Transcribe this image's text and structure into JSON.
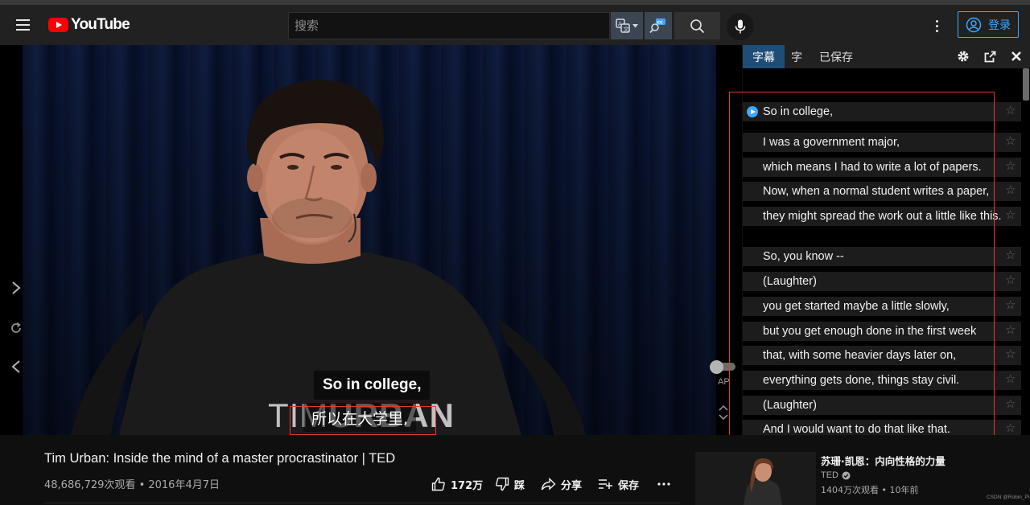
{
  "header": {
    "logo_text": "YouTube",
    "search_placeholder": "搜索",
    "login_label": "登录"
  },
  "player": {
    "caption_en": "So in college,",
    "caption_zh": "所以在大学里,",
    "speaker_first": "TIM",
    "speaker_last": "URBAN",
    "autoplay_label": "AP"
  },
  "panel": {
    "tabs": [
      {
        "label": "字幕",
        "active": true
      },
      {
        "label": "字",
        "active": false
      },
      {
        "label": "已保存",
        "active": false
      }
    ],
    "lines": [
      {
        "text": "So in college,",
        "playing": true
      },
      {
        "text": "I was a government major,",
        "playing": false
      },
      {
        "text": "which means I had to write a lot of papers.",
        "playing": false
      },
      {
        "text": "Now, when a normal student writes a paper,",
        "playing": false
      },
      {
        "text": "they might spread the work out a little like this.",
        "playing": false
      },
      {
        "text": "So, you know --",
        "playing": false
      },
      {
        "text": "(Laughter)",
        "playing": false
      },
      {
        "text": "you get started maybe a little slowly,",
        "playing": false
      },
      {
        "text": "but you get enough done in the first week",
        "playing": false
      },
      {
        "text": "that, with some heavier days later on,",
        "playing": false
      },
      {
        "text": "everything gets done, things stay civil.",
        "playing": false
      },
      {
        "text": "(Laughter)",
        "playing": false
      },
      {
        "text": "And I would want to do that like that.",
        "playing": false
      }
    ]
  },
  "video": {
    "title": "Tim Urban: Inside the mind of a master procrastinator | TED",
    "meta": "48,686,729次观看 • 2016年4月7日",
    "like_count": "172万",
    "dislike_label": "踩",
    "share_label": "分享",
    "save_label": "保存"
  },
  "recommendation": {
    "title": "苏珊·凯恩：内向性格的力量",
    "channel": "TED",
    "meta": "1404万次观看 • 10年前"
  },
  "watermark": "CSDN @Robin_Pi",
  "colors": {
    "accent_blue": "#3ea6ff",
    "brand_red": "#ff0000",
    "annotation_red": "#e53935",
    "active_tab": "#1e4d78"
  }
}
